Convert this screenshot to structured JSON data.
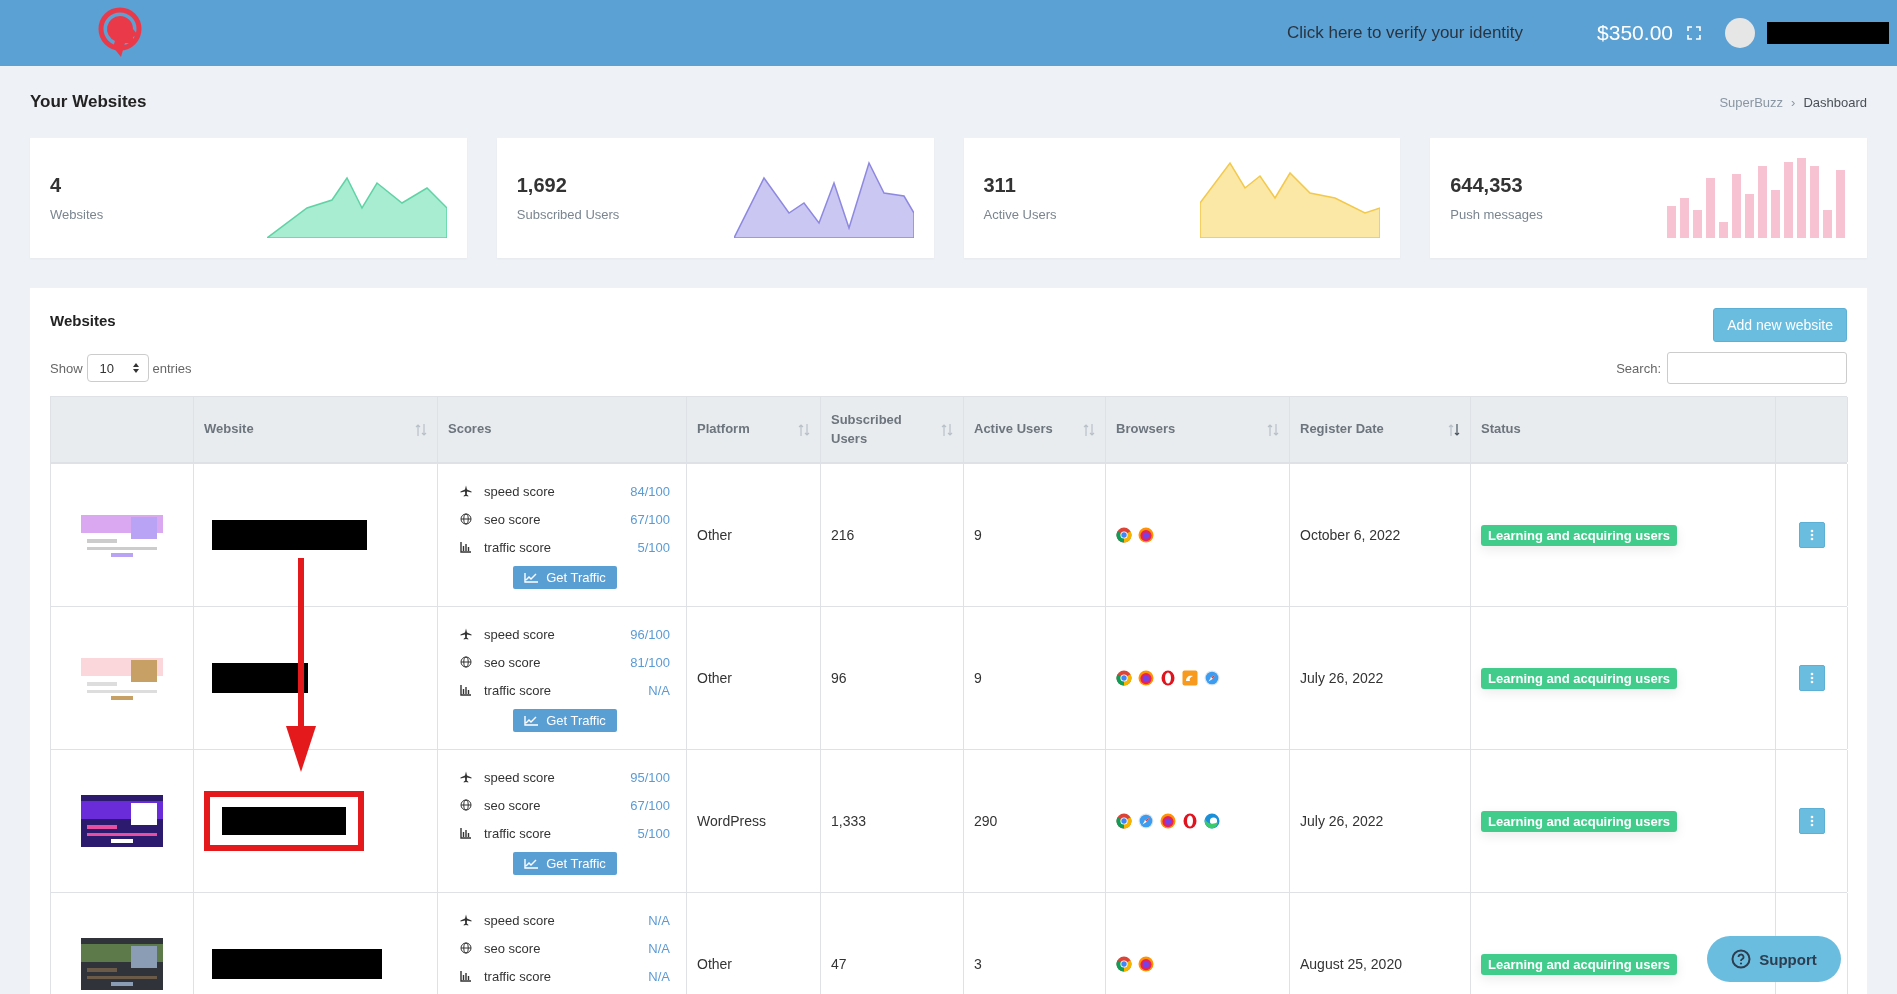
{
  "header": {
    "verify_link": "Click here to verify your identity",
    "balance": "$350.00"
  },
  "page_title": "Your Websites",
  "breadcrumb": {
    "separator": "›",
    "items": [
      {
        "label": "SuperBuzz"
      },
      {
        "label": "Dashboard"
      }
    ]
  },
  "stats": [
    {
      "value": "4",
      "label": "Websites",
      "kind": "area",
      "color": "#a8ecd1"
    },
    {
      "value": "1,692",
      "label": "Subscribed Users",
      "kind": "area",
      "color": "#cac7f3"
    },
    {
      "value": "311",
      "label": "Active Users",
      "kind": "area",
      "color": "#fbe7a6"
    },
    {
      "value": "644,353",
      "label": "Push messages",
      "kind": "bar",
      "color": "#f7c2d2"
    }
  ],
  "panel": {
    "title": "Websites",
    "add_button": "Add new website",
    "show_label": "Show",
    "entries_value": "10",
    "entries_label": "entries",
    "search_label": "Search:"
  },
  "table": {
    "columns": [
      {
        "sortable": false
      },
      {
        "label": "Website",
        "sortable": true,
        "sorted": false
      },
      {
        "label": "Scores",
        "sortable": false
      },
      {
        "label": "Platform",
        "sortable": true,
        "sorted": false
      },
      {
        "label": "Subscribed Users",
        "sortable": true,
        "sorted": false
      },
      {
        "label": "Active Users",
        "sortable": true,
        "sorted": false
      },
      {
        "label": "Browsers",
        "sortable": true,
        "sorted": false
      },
      {
        "label": "Register Date",
        "sortable": true,
        "sorted": true
      },
      {
        "label": "Status",
        "sortable": false
      },
      {
        "sortable": false
      }
    ],
    "rows": [
      {
        "highlighted": false,
        "scores": [
          {
            "kind": "speed",
            "label": "speed score",
            "value": "84/100"
          },
          {
            "kind": "seo",
            "label": "seo score",
            "value": "67/100"
          },
          {
            "kind": "traffic",
            "label": "traffic score",
            "value": "5/100"
          }
        ],
        "button": "Get Traffic",
        "platform": "Other",
        "subscribed": "216",
        "active": "9",
        "browsers": [
          {
            "kind": "chrome"
          },
          {
            "kind": "firefox"
          }
        ],
        "date": "October 6, 2022",
        "status": "Learning and acquiring users",
        "menu": true
      },
      {
        "highlighted": false,
        "scores": [
          {
            "kind": "speed",
            "label": "speed score",
            "value": "96/100"
          },
          {
            "kind": "seo",
            "label": "seo score",
            "value": "81/100"
          },
          {
            "kind": "traffic",
            "label": "traffic score",
            "value": "N/A"
          }
        ],
        "button": "Get Traffic",
        "platform": "Other",
        "subscribed": "96",
        "active": "9",
        "browsers": [
          {
            "kind": "chrome"
          },
          {
            "kind": "firefox"
          },
          {
            "kind": "opera"
          },
          {
            "kind": "uc"
          },
          {
            "kind": "safari"
          }
        ],
        "date": "July 26, 2022",
        "status": "Learning and acquiring users",
        "menu": true
      },
      {
        "highlighted": true,
        "scores": [
          {
            "kind": "speed",
            "label": "speed score",
            "value": "95/100"
          },
          {
            "kind": "seo",
            "label": "seo score",
            "value": "67/100"
          },
          {
            "kind": "traffic",
            "label": "traffic score",
            "value": "5/100"
          }
        ],
        "button": "Get Traffic",
        "platform": "WordPress",
        "subscribed": "1,333",
        "active": "290",
        "browsers": [
          {
            "kind": "chrome"
          },
          {
            "kind": "safari"
          },
          {
            "kind": "firefox"
          },
          {
            "kind": "opera"
          },
          {
            "kind": "edge"
          }
        ],
        "date": "July 26, 2022",
        "status": "Learning and acquiring users",
        "menu": true
      },
      {
        "highlighted": false,
        "scores": [
          {
            "kind": "speed",
            "label": "speed score",
            "value": "N/A"
          },
          {
            "kind": "seo",
            "label": "seo score",
            "value": "N/A"
          },
          {
            "kind": "traffic",
            "label": "traffic score",
            "value": "N/A"
          }
        ],
        "platform": "Other",
        "subscribed": "47",
        "active": "3",
        "browsers": [
          {
            "kind": "chrome"
          },
          {
            "kind": "firefox"
          }
        ],
        "date": "August 25, 2020",
        "status": "Learning and acquiring users"
      }
    ]
  },
  "support_button": "Support"
}
